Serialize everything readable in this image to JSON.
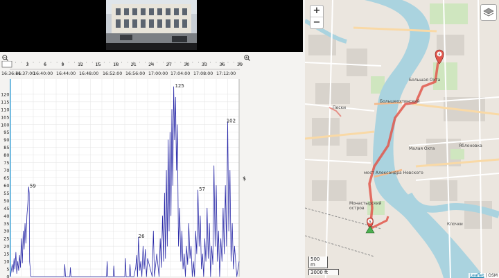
{
  "timeline": {
    "ticks": [
      "0",
      "3",
      "6",
      "9",
      "12",
      "15",
      "18",
      "21",
      "24",
      "27",
      "30",
      "33",
      "36",
      "39"
    ],
    "times": [
      "16:36:41",
      "16:37:00",
      "16:40:00",
      "16:44:00",
      "16:48:00",
      "16:52:00",
      "16:56:00",
      "17:00:00",
      "17:04:00",
      "17:08:00",
      "17:12:00"
    ]
  },
  "chart_data": {
    "type": "line",
    "ylim": [
      0,
      130
    ],
    "yticks": [
      "0",
      "5",
      "10",
      "15",
      "20",
      "25",
      "30",
      "35",
      "40",
      "45",
      "50",
      "55",
      "60",
      "65",
      "70",
      "75",
      "80",
      "85",
      "90",
      "95",
      "100",
      "105",
      "110",
      "115",
      "120"
    ],
    "right_label": "$",
    "peak_labels": [
      {
        "label": "59",
        "x": 0.08,
        "y": 59
      },
      {
        "label": "26",
        "x": 0.555,
        "y": 26
      },
      {
        "label": "125",
        "x": 0.715,
        "y": 125
      },
      {
        "label": "57",
        "x": 0.82,
        "y": 57
      },
      {
        "label": "102",
        "x": 0.94,
        "y": 102
      }
    ],
    "x": [
      0.0,
      0.008,
      0.012,
      0.016,
      0.02,
      0.024,
      0.028,
      0.032,
      0.036,
      0.04,
      0.044,
      0.048,
      0.052,
      0.056,
      0.06,
      0.064,
      0.068,
      0.072,
      0.076,
      0.08,
      0.082,
      0.084,
      0.09,
      0.1,
      0.2,
      0.235,
      0.238,
      0.241,
      0.26,
      0.262,
      0.265,
      0.3,
      0.42,
      0.423,
      0.426,
      0.45,
      0.452,
      0.455,
      0.47,
      0.5,
      0.503,
      0.506,
      0.52,
      0.523,
      0.526,
      0.54,
      0.548,
      0.552,
      0.556,
      0.56,
      0.566,
      0.57,
      0.575,
      0.58,
      0.585,
      0.59,
      0.595,
      0.6,
      0.62,
      0.625,
      0.63,
      0.64,
      0.65,
      0.655,
      0.66,
      0.665,
      0.67,
      0.674,
      0.678,
      0.682,
      0.686,
      0.69,
      0.694,
      0.698,
      0.702,
      0.706,
      0.71,
      0.714,
      0.718,
      0.722,
      0.726,
      0.73,
      0.735,
      0.74,
      0.745,
      0.75,
      0.755,
      0.76,
      0.765,
      0.77,
      0.775,
      0.78,
      0.785,
      0.79,
      0.795,
      0.8,
      0.805,
      0.81,
      0.815,
      0.82,
      0.825,
      0.83,
      0.835,
      0.84,
      0.845,
      0.85,
      0.855,
      0.86,
      0.865,
      0.87,
      0.875,
      0.88,
      0.885,
      0.89,
      0.895,
      0.9,
      0.905,
      0.91,
      0.915,
      0.92,
      0.925,
      0.93,
      0.935,
      0.94,
      0.945,
      0.95,
      0.955,
      0.96,
      0.965,
      0.97,
      0.975,
      0.98,
      0.99,
      1.0
    ],
    "y": [
      0,
      8,
      3,
      12,
      5,
      16,
      2,
      10,
      4,
      14,
      6,
      25,
      9,
      30,
      18,
      35,
      22,
      40,
      48,
      59,
      55,
      10,
      0,
      0,
      0,
      0,
      8,
      0,
      0,
      6,
      0,
      0,
      0,
      10,
      0,
      0,
      7,
      0,
      0,
      0,
      12,
      0,
      0,
      8,
      0,
      0,
      6,
      14,
      0,
      26,
      4,
      10,
      0,
      20,
      5,
      18,
      0,
      12,
      0,
      30,
      0,
      15,
      0,
      25,
      6,
      40,
      10,
      55,
      12,
      70,
      20,
      90,
      30,
      95,
      40,
      110,
      60,
      125,
      90,
      118,
      70,
      100,
      20,
      45,
      10,
      30,
      5,
      15,
      0,
      20,
      8,
      35,
      12,
      20,
      0,
      10,
      0,
      30,
      15,
      57,
      20,
      40,
      5,
      15,
      0,
      25,
      10,
      45,
      12,
      35,
      0,
      20,
      8,
      73,
      20,
      60,
      10,
      30,
      0,
      25,
      10,
      45,
      15,
      60,
      20,
      102,
      30,
      70,
      10,
      35,
      5,
      20,
      0,
      10,
      0,
      0
    ]
  },
  "map": {
    "zoom_in": "+",
    "zoom_out": "−",
    "scale_m": "500 m",
    "scale_ft": "3000 ft",
    "attribution_link": "Leaflet",
    "attribution_sep": " | OSM",
    "labels": {
      "pesk": "Пески",
      "bolsh_okhta": "Большая Охта",
      "malaya_okhta": "Малая Охта",
      "yablonovka": "Яблоновка",
      "monastyr": "Монастырский остров",
      "klochki": "Клочки",
      "bolsheokhtinsky": "Большеохтинский",
      "aleksandro": "мост Александра Невского"
    },
    "marker_start": "S",
    "marker_finish": "F"
  }
}
